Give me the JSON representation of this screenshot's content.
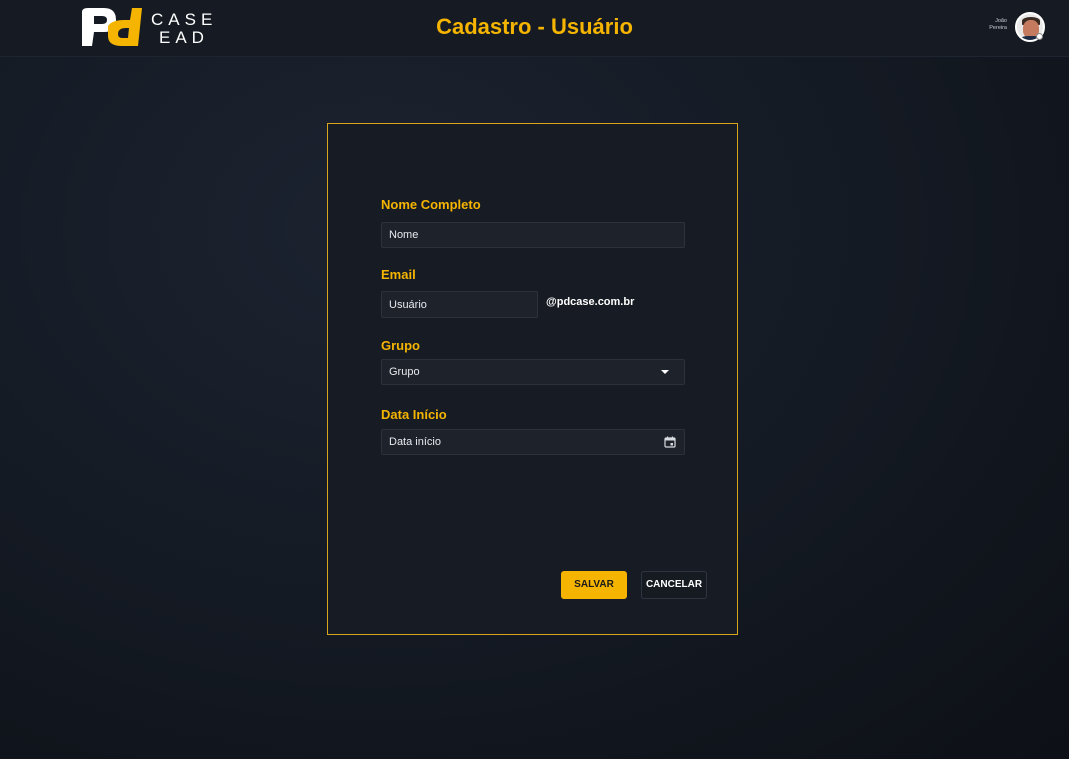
{
  "header": {
    "logo_mark": "pd",
    "logo_word_line1": "CASE",
    "logo_word_line2": "EAD",
    "title": "Cadastro - Usuário",
    "user_first_name": "João",
    "user_last_name": "Pereira"
  },
  "form": {
    "name": {
      "label": "Nome Completo",
      "placeholder": "Nome"
    },
    "email": {
      "label": "Email",
      "placeholder": "Usuário",
      "suffix": "@pdcase.com.br"
    },
    "group": {
      "label": "Grupo",
      "selected": "Grupo"
    },
    "start_date": {
      "label": "Data Início",
      "placeholder": "Data início"
    }
  },
  "actions": {
    "save_label": "SALVAR",
    "cancel_label": "CANCELAR"
  },
  "colors": {
    "accent": "#f5b400",
    "background": "#151b25",
    "card": "#171c24",
    "border": "#d9a51c"
  },
  "icons": [
    "pd-logo-icon",
    "chevron-down-icon",
    "calendar-icon",
    "avatar"
  ]
}
